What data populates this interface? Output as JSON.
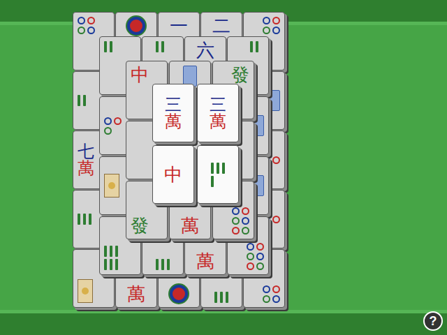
{
  "board": {
    "layers": [
      {
        "rows": [
          [
            {
              "kind": "dots",
              "count": 4
            },
            {
              "kind": "dots",
              "count": 1
            },
            {
              "kind": "glyph",
              "text": "一",
              "color": "#1a2a8a"
            },
            {
              "kind": "glyph",
              "text": "二",
              "color": "#1a2a8a"
            },
            {
              "kind": "dots",
              "count": 4
            }
          ],
          [
            {
              "kind": "bamboo",
              "count": 2
            },
            {
              "kind": "hidden"
            },
            {
              "kind": "hidden"
            },
            {
              "kind": "hidden"
            },
            {
              "kind": "season"
            }
          ],
          [
            {
              "kind": "character",
              "number": "七",
              "suit": "萬"
            },
            {
              "kind": "hidden"
            },
            {
              "kind": "hidden"
            },
            {
              "kind": "hidden"
            },
            {
              "kind": "dots",
              "count": 2
            }
          ],
          [
            {
              "kind": "bamboo",
              "count": 3
            },
            {
              "kind": "hidden"
            },
            {
              "kind": "hidden"
            },
            {
              "kind": "hidden"
            },
            {
              "kind": "dots",
              "count": 2
            }
          ],
          [
            {
              "kind": "flower"
            },
            {
              "kind": "glyph",
              "text": "萬",
              "color": "#c62828"
            },
            {
              "kind": "dots",
              "count": 1
            },
            {
              "kind": "bamboo",
              "count": 3
            },
            {
              "kind": "dots",
              "count": 4
            }
          ]
        ]
      },
      {
        "rows": [
          [
            {
              "kind": "bamboo",
              "count": 2
            },
            {
              "kind": "bamboo",
              "count": 2
            },
            {
              "kind": "glyph",
              "text": "六",
              "color": "#1a2a8a"
            },
            {
              "kind": "bamboo",
              "count": 2
            }
          ],
          [
            {
              "kind": "dots",
              "count": 3
            },
            {
              "kind": "hidden"
            },
            {
              "kind": "hidden"
            },
            {
              "kind": "season"
            }
          ],
          [
            {
              "kind": "flower"
            },
            {
              "kind": "hidden"
            },
            {
              "kind": "hidden"
            },
            {
              "kind": "season"
            }
          ],
          [
            {
              "kind": "bamboo",
              "count": 6
            },
            {
              "kind": "bamboo",
              "count": 3
            },
            {
              "kind": "glyph",
              "text": "萬",
              "color": "#c62828"
            },
            {
              "kind": "dots",
              "count": 6
            }
          ]
        ]
      },
      {
        "rows": [
          [
            {
              "kind": "glyph",
              "text": "中",
              "color": "#c62828"
            },
            {
              "kind": "season"
            },
            {
              "kind": "glyph",
              "text": "發",
              "color": "#2e7d32"
            }
          ],
          [
            {
              "kind": "hidden"
            },
            {
              "kind": "hidden"
            },
            {
              "kind": "hidden"
            }
          ],
          [
            {
              "kind": "glyph",
              "text": "發",
              "color": "#2e7d32"
            },
            {
              "kind": "glyph",
              "text": "萬",
              "color": "#c62828"
            },
            {
              "kind": "dots",
              "count": 6
            }
          ]
        ]
      },
      {
        "rows": [
          [
            {
              "kind": "character",
              "number": "三",
              "suit": "萬"
            },
            {
              "kind": "character",
              "number": "三",
              "suit": "萬"
            }
          ],
          [
            {
              "kind": "glyph",
              "text": "中",
              "color": "#c62828"
            },
            {
              "kind": "bamboo",
              "count": 4
            }
          ]
        ]
      }
    ]
  },
  "help_button": {
    "label": "?"
  }
}
